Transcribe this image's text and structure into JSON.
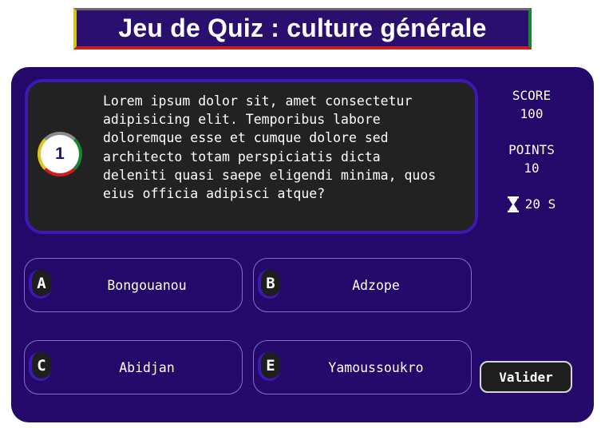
{
  "header": {
    "title": "Jeu de Quiz : culture générale"
  },
  "question": {
    "number": "1",
    "text": "Lorem ipsum dolor sit, amet consectetur\nadipisicing elit. Temporibus labore\ndoloremque esse et cumque dolore sed\narchitecto totam perspiciatis dicta\ndeleniti quasi saepe eligendi minima, quos\neius officia adipisci atque?"
  },
  "stats": {
    "score_label": "SCORE",
    "score_value": "100",
    "points_label": "POINTS",
    "points_value": "10",
    "timer_icon": "hourglass-icon",
    "timer_value": "20 S"
  },
  "answers": [
    {
      "letter": "A",
      "text": "Bongouanou"
    },
    {
      "letter": "B",
      "text": "Adzope"
    },
    {
      "letter": "C",
      "text": "Abidjan"
    },
    {
      "letter": "E",
      "text": "Yamoussoukro"
    }
  ],
  "actions": {
    "validate_label": "Valider"
  },
  "colors": {
    "panel": "#24086a",
    "accent": "#3e18b4",
    "question_bg": "#222222",
    "yellow": "#e0c51f",
    "green": "#17862d",
    "red": "#d11b1b"
  }
}
